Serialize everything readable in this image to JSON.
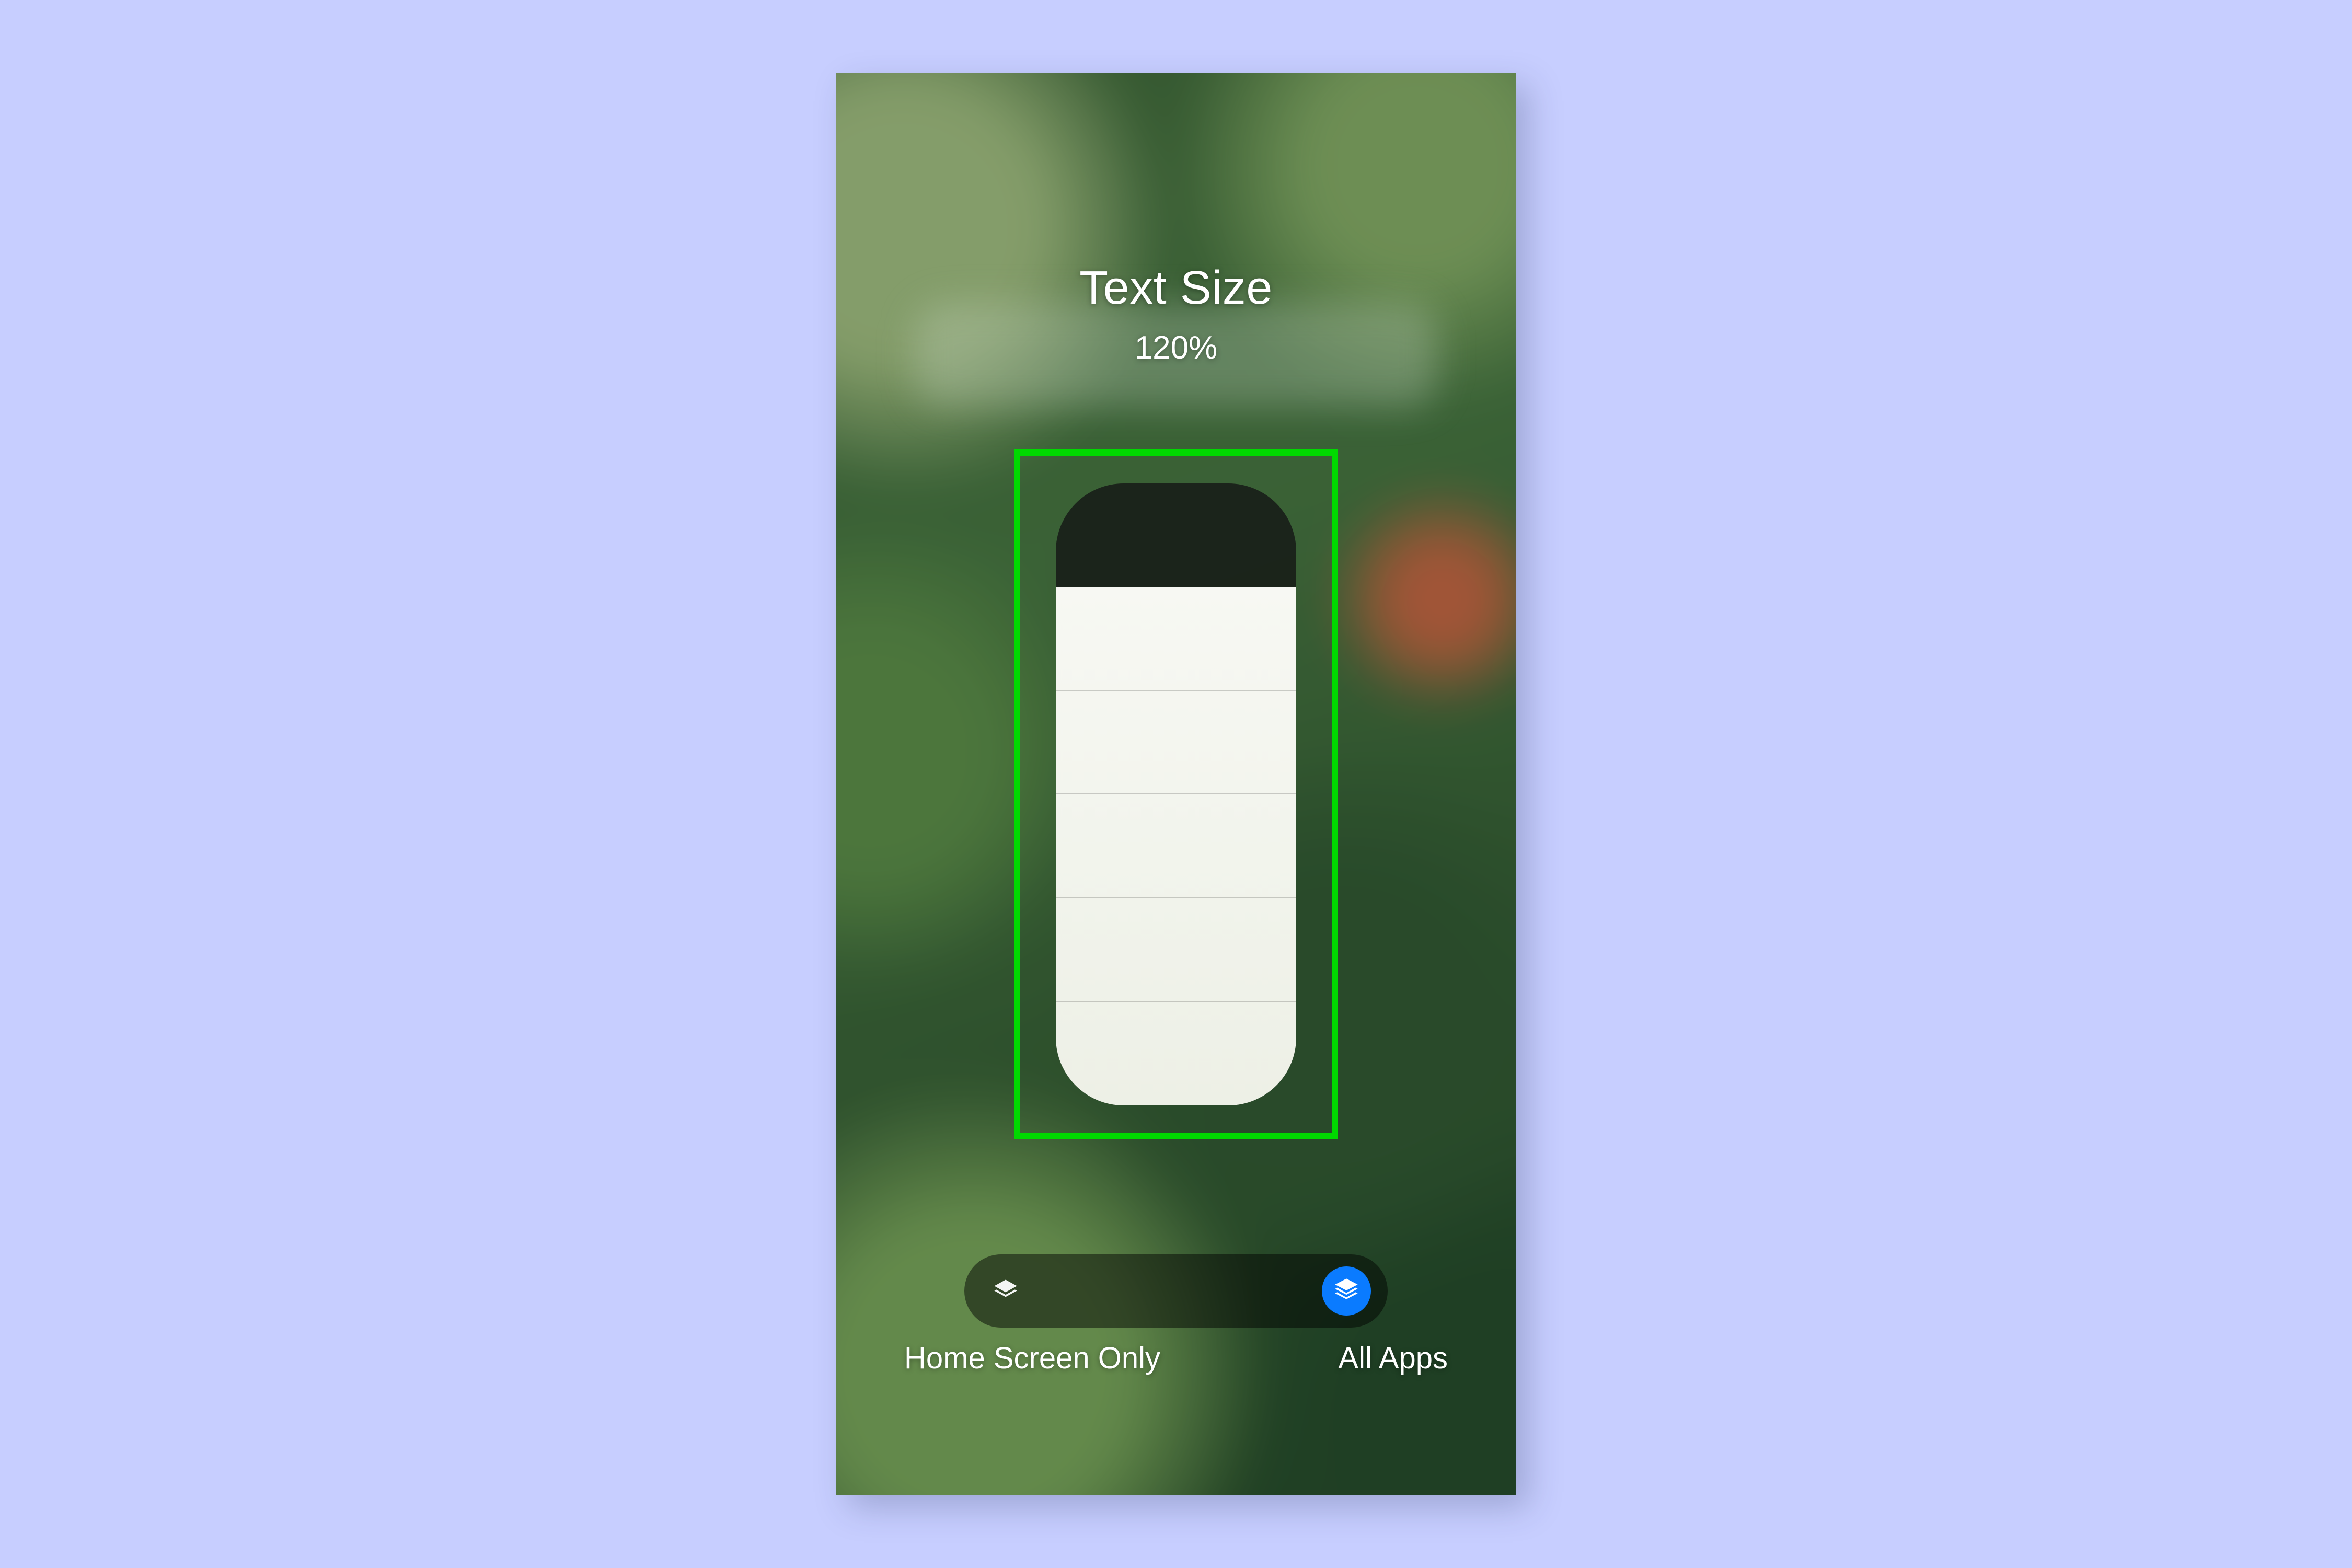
{
  "panel": {
    "title": "Text Size",
    "value": "120%",
    "slider": {
      "steps_total": 6,
      "steps_filled": 5
    },
    "scope": {
      "options": [
        {
          "id": "home",
          "label": "Home Screen Only",
          "icon": "layers-single-icon",
          "selected": false
        },
        {
          "id": "all",
          "label": "All Apps",
          "icon": "layers-stack-icon",
          "selected": true
        }
      ]
    }
  },
  "annotation": {
    "highlight_color": "#00d900"
  }
}
